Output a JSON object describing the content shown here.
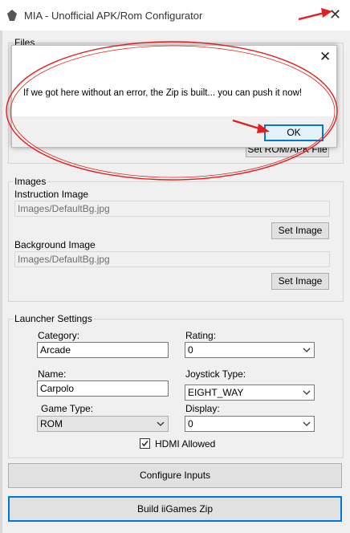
{
  "window": {
    "title": "MIA - Unofficial APK/Rom Configurator",
    "close_glyph": "✕"
  },
  "files": {
    "group_label": "Files",
    "set_button_label": "Set ROM/APK File"
  },
  "images": {
    "group_label": "Images",
    "instruction_label": "Instruction Image",
    "instruction_value": "Images/DefaultBg.jpg",
    "instruction_button": "Set Image",
    "background_label": "Background Image",
    "background_value": "Images/DefaultBg.jpg",
    "background_button": "Set Image"
  },
  "launcher": {
    "group_label": "Launcher Settings",
    "category_label": "Category:",
    "category_value": "Arcade",
    "rating_label": "Rating:",
    "rating_value": "0",
    "name_label": "Name:",
    "name_value": "Carpolo",
    "joystick_label": "Joystick Type:",
    "joystick_value": "EIGHT_WAY",
    "gametype_label": "Game Type:",
    "gametype_value": "ROM",
    "display_label": "Display:",
    "display_value": "0",
    "hdmi_label": "HDMI Allowed",
    "hdmi_checked": true
  },
  "buttons": {
    "configure_inputs": "Configure Inputs",
    "build_zip": "Build iiGames Zip"
  },
  "dialog": {
    "message": "If we got here without an error, the Zip is built... you can push it now!",
    "ok_label": "OK",
    "close_glyph": "✕"
  },
  "annotation_color": "#e02020"
}
